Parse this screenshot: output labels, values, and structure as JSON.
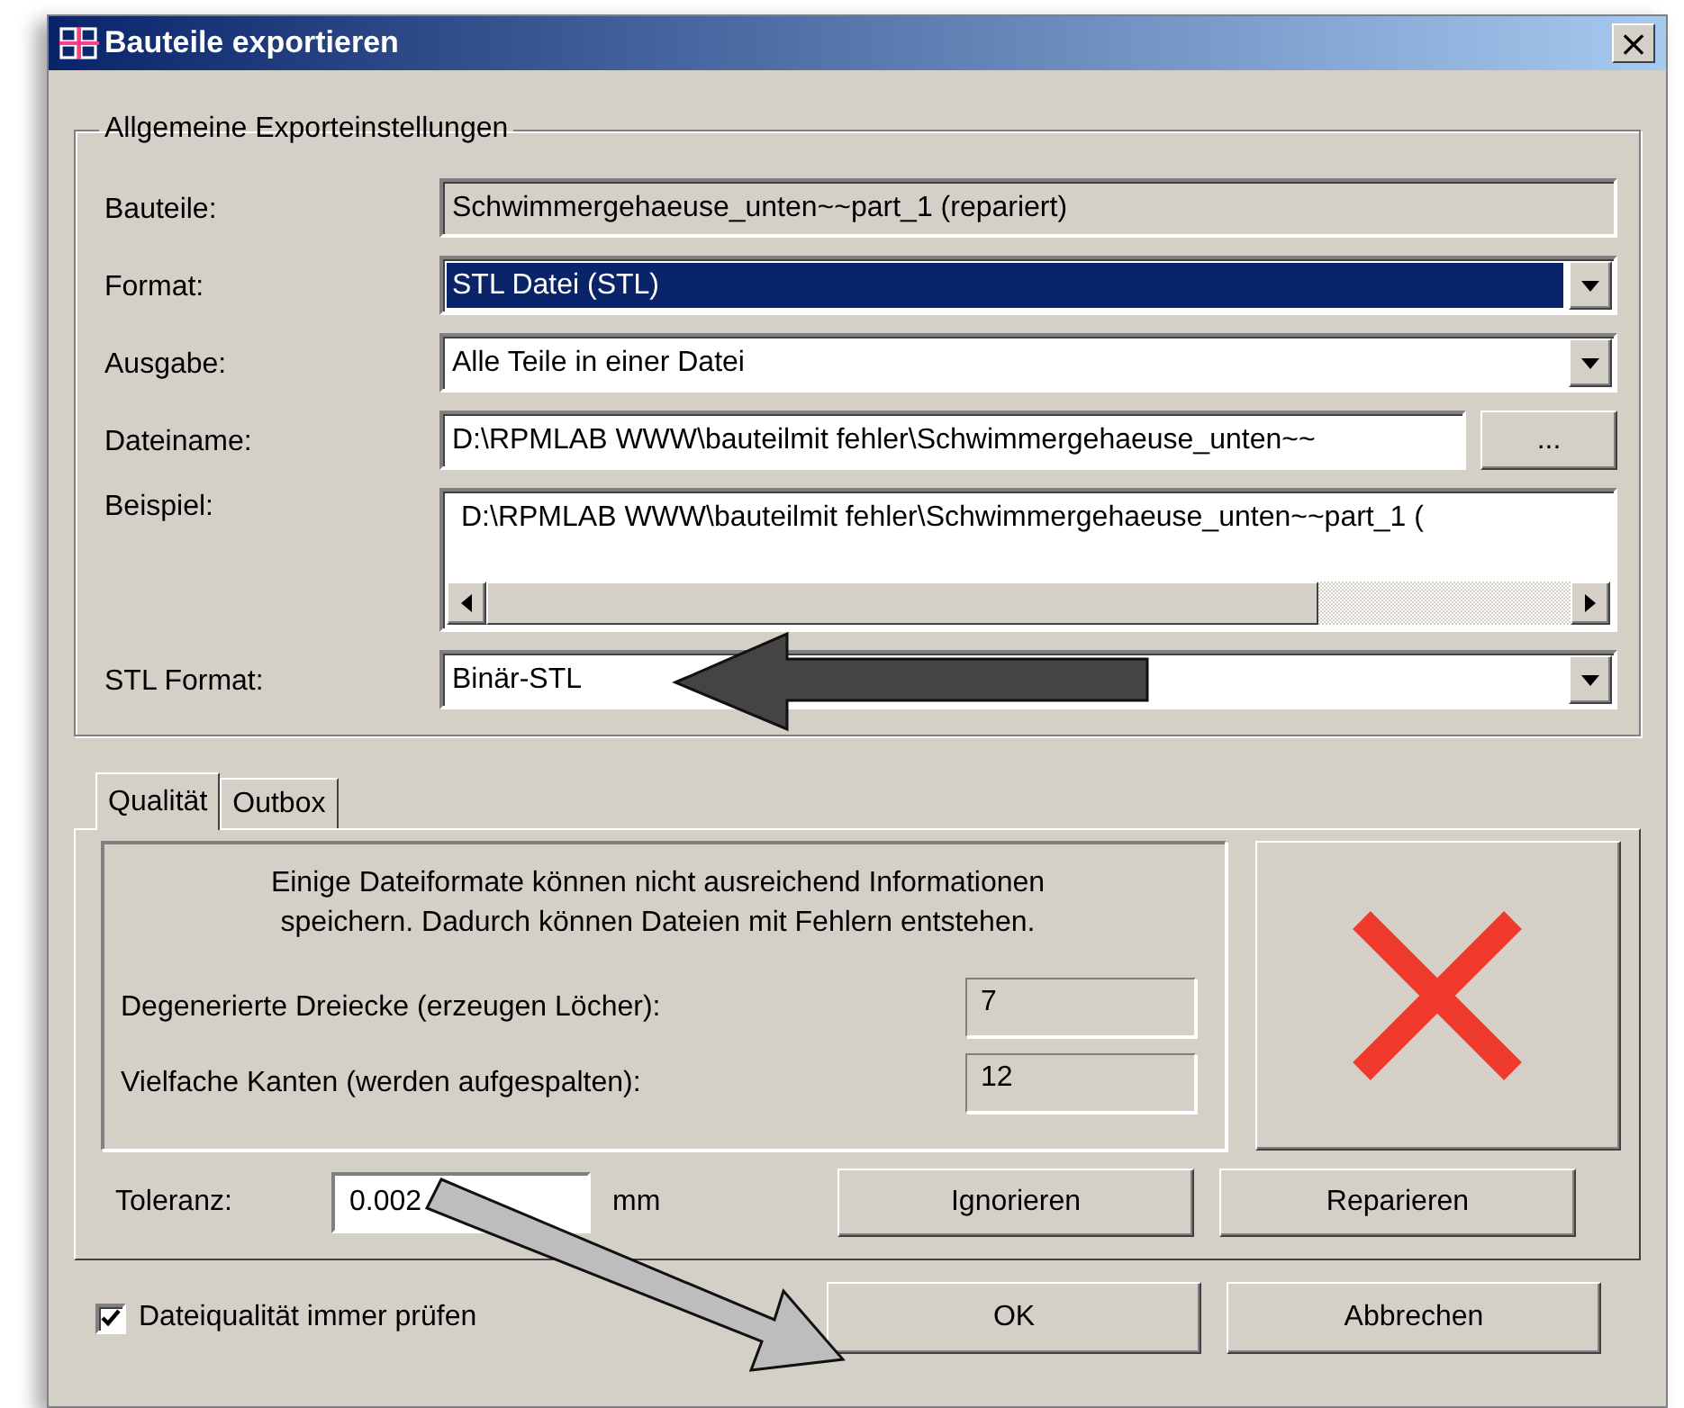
{
  "window": {
    "title": "Bauteile exportieren",
    "close": "×"
  },
  "general": {
    "legend": "Allgemeine Exporteinstellungen",
    "fields": [
      {
        "kind": "readonly",
        "label": "Bauteile:",
        "value": "Schwimmergehaeuse_unten~~part_1 (repariert)"
      },
      {
        "kind": "select",
        "label": "Format:",
        "value": "STL Datei (STL)",
        "focused": true
      },
      {
        "kind": "select",
        "label": "Ausgabe:",
        "value": "Alle Teile in einer Datei",
        "focused": false
      },
      {
        "kind": "browse",
        "label": "Dateiname:",
        "value": "D:\\RPMLAB WWW\\bauteilmit fehler\\Schwimmergehaeuse_unten~~",
        "button": "..."
      },
      {
        "kind": "scroll",
        "label": "Beispiel:",
        "value": "D:\\RPMLAB WWW\\bauteilmit fehler\\Schwimmergehaeuse_unten~~part_1 ("
      },
      {
        "kind": "select",
        "label": "STL Format:",
        "value": "Binär-STL",
        "focused": false
      }
    ]
  },
  "tabs": [
    {
      "label": "Qualität",
      "selected": true
    },
    {
      "label": "Outbox",
      "selected": false
    }
  ],
  "quality": {
    "message": "Einige Dateiformate können nicht ausreichend Informationen speichern. Dadurch können Dateien mit Fehlern entstehen.",
    "passed": false,
    "counts": [
      {
        "label": "Degenerierte Dreiecke (erzeugen Löcher):",
        "value": "7"
      },
      {
        "label": "Vielfache Kanten (werden aufgespalten):",
        "value": "12"
      }
    ]
  },
  "tolerance": {
    "label": "Toleranz:",
    "value": "0.002",
    "unit": "mm"
  },
  "quality_buttons": [
    "Ignorieren",
    "Reparieren"
  ],
  "always_check": {
    "label": "Dateiqualität immer prüfen",
    "checked": true
  },
  "buttons": [
    "OK",
    "Abbrechen"
  ]
}
